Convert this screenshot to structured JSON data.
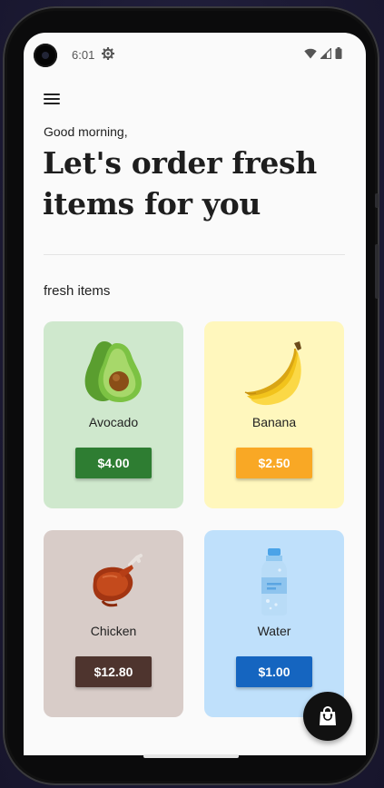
{
  "status_bar": {
    "time": "6:01",
    "icons": [
      "settings-icon",
      "wifi-icon",
      "signal-icon",
      "battery-icon"
    ]
  },
  "header": {
    "menu_icon": "menu-icon",
    "greeting": "Good morning,",
    "headline": "Let's order fresh items for you"
  },
  "section": {
    "title": "fresh items"
  },
  "items": [
    {
      "name": "Avocado",
      "price": "$4.00",
      "icon": "avocado-icon",
      "card_color": "#cfe8cd",
      "button_color": "#2e7d32"
    },
    {
      "name": "Banana",
      "price": "$2.50",
      "icon": "banana-icon",
      "card_color": "#fff7bd",
      "button_color": "#f9a825"
    },
    {
      "name": "Chicken",
      "price": "$12.80",
      "icon": "chicken-icon",
      "card_color": "#d8ccc8",
      "button_color": "#4e342e"
    },
    {
      "name": "Water",
      "price": "$1.00",
      "icon": "water-bottle-icon",
      "card_color": "#bfe0fb",
      "button_color": "#1565c0"
    }
  ],
  "fab": {
    "icon": "shopping-bag-icon"
  }
}
